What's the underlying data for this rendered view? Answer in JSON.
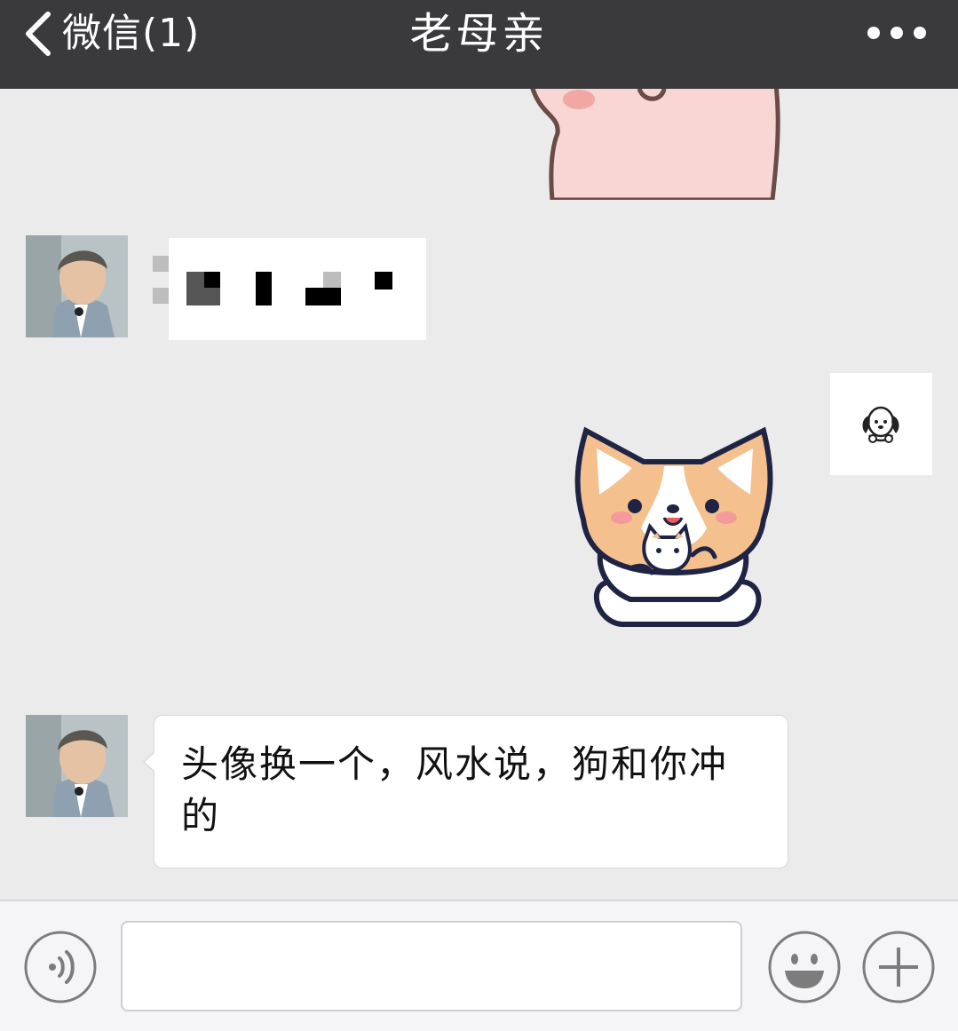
{
  "header": {
    "back_label": "微信(1)",
    "title": "老母亲",
    "more_icon": "ellipsis-icon",
    "background": "#3a3a3c"
  },
  "messages": [
    {
      "side": "right",
      "type": "sticker",
      "sticker": "pink-animal-sticker (partial)"
    },
    {
      "side": "left",
      "type": "text",
      "content": "pixelated-redacted"
    },
    {
      "side": "right",
      "type": "sticker",
      "sticker": "corgi-holding-corgi-sticker"
    },
    {
      "side": "left",
      "type": "text",
      "text": "头像换一个，风水说，狗和你冲的"
    }
  ],
  "input_bar": {
    "voice_icon": "voice-icon",
    "message_value": "",
    "emoji_icon": "smiley-icon",
    "add_icon": "plus-icon"
  },
  "colors": {
    "chat_background": "#ebebeb",
    "bubble": "#ffffff",
    "input_bar": "#f5f5f7"
  }
}
